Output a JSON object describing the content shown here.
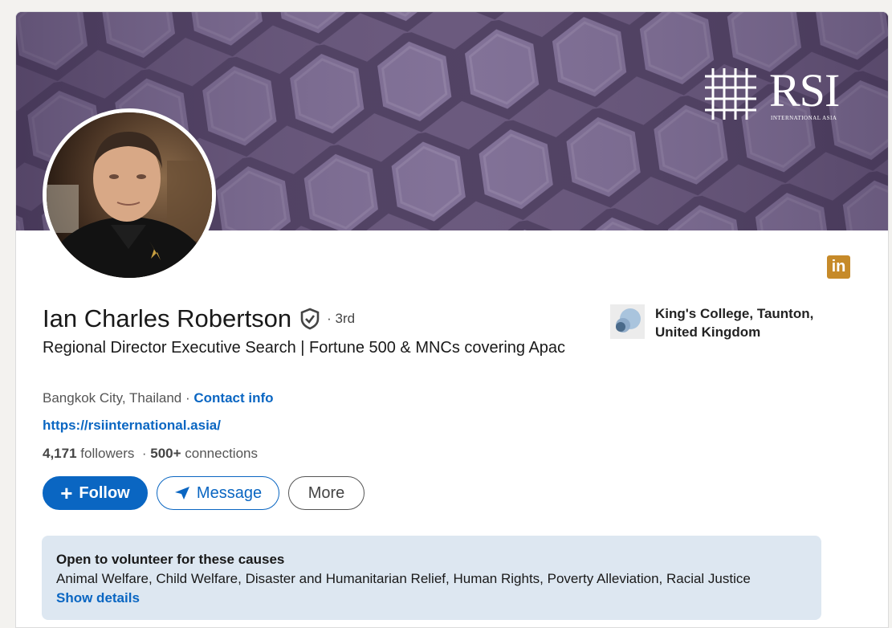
{
  "banner": {
    "brand_name": "RSI",
    "brand_sub": "INTERNATIONAL ASIA",
    "colors": {
      "banner": "#6b5a7e",
      "frame": "#5a4a6c"
    }
  },
  "profile": {
    "name": "Ian Charles Robertson",
    "degree": "· 3rd",
    "headline": "Regional Director Executive Search | Fortune 500 & MNCs covering Apac",
    "location": "Bangkok City, Thailand",
    "location_sep": " · ",
    "contact_label": "Contact info",
    "website": "https://rsiinternational.asia/",
    "followers_count": "4,171",
    "followers_label": "followers",
    "connections_sep": "·",
    "connections_count": "500+",
    "connections_label": "connections",
    "badge": "in"
  },
  "actions": {
    "follow_label": "Follow",
    "message_label": "Message",
    "more_label": "More"
  },
  "education": {
    "school": "King's College, Taunton, United Kingdom"
  },
  "volunteer": {
    "title": "Open to volunteer for these causes",
    "causes": "Animal Welfare, Child Welfare, Disaster and Humanitarian Relief, Human Rights, Poverty Alleviation, Racial Justice",
    "link": "Show details"
  },
  "colors": {
    "accent": "#0a66c2",
    "linkedin_badge": "#c68a29",
    "volunteer_bg": "#dde7f1"
  }
}
